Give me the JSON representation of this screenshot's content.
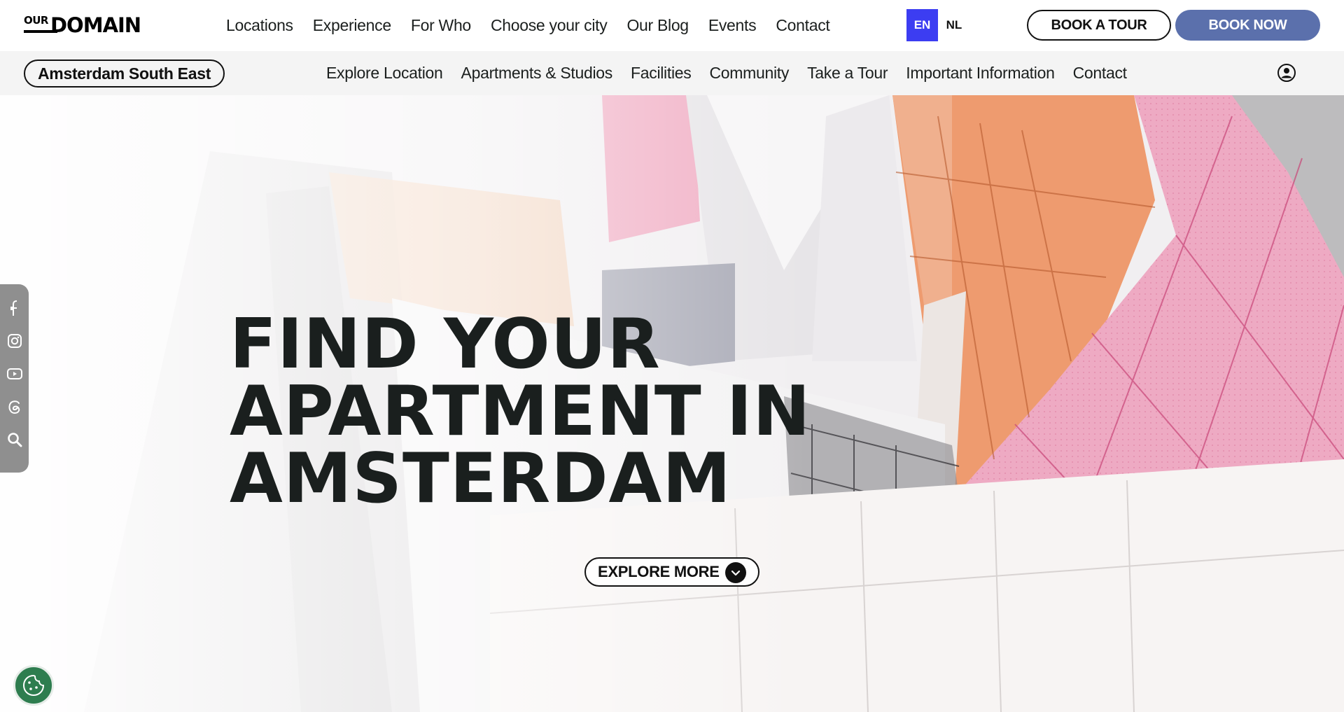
{
  "header": {
    "logo_small": "OUR",
    "logo_big": "DOMAIN",
    "nav": [
      "Locations",
      "Experience",
      "For Who",
      "Choose your city",
      "Our Blog",
      "Events",
      "Contact"
    ],
    "lang_en": "EN",
    "lang_nl": "NL",
    "book_tour": "BOOK A TOUR",
    "book_now": "BOOK NOW"
  },
  "subheader": {
    "location": "Amsterdam South East",
    "nav": [
      "Explore Location",
      "Apartments & Studios",
      "Facilities",
      "Community",
      "Take a Tour",
      "Important Information",
      "Contact"
    ],
    "account_icon": "user-circle-icon"
  },
  "hero": {
    "title_lines": [
      "FIND YOUR",
      "APARTMENT IN",
      "AMSTERDAM"
    ],
    "explore": "EXPLORE MORE"
  },
  "social": [
    "facebook-icon",
    "instagram-icon",
    "youtube-icon",
    "threads-icon",
    "search-icon"
  ],
  "colors": {
    "accent_blue": "#3c3df2",
    "book_now": "#5b70ac",
    "cookie_green": "#2e7d4f",
    "social_bg": "#8f8f8f"
  }
}
